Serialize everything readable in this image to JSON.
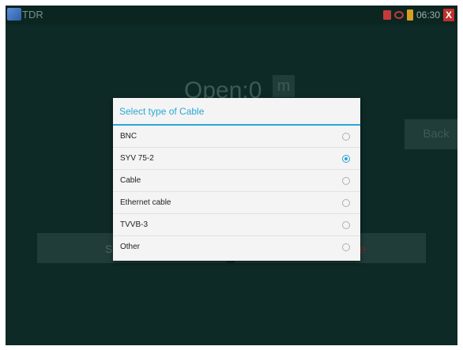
{
  "app": {
    "title": "TDR"
  },
  "status_bar": {
    "time": "06:30",
    "close_label": "X"
  },
  "main": {
    "open_label": "Open:0",
    "unit": "m",
    "back_label": "Back",
    "bottom_left_label": "S",
    "bottom_right_label": "e"
  },
  "dialog": {
    "title": "Select type of Cable",
    "options": [
      {
        "label": "BNC",
        "selected": false
      },
      {
        "label": "SYV 75-2",
        "selected": true
      },
      {
        "label": "Cable",
        "selected": false
      },
      {
        "label": "Ethernet cable",
        "selected": false
      },
      {
        "label": "TVVB-3",
        "selected": false
      },
      {
        "label": "Other",
        "selected": false
      }
    ]
  },
  "colors": {
    "background": "#0d2a26",
    "accent": "#2aa6d6",
    "dialog_bg": "#f4f4f4"
  }
}
